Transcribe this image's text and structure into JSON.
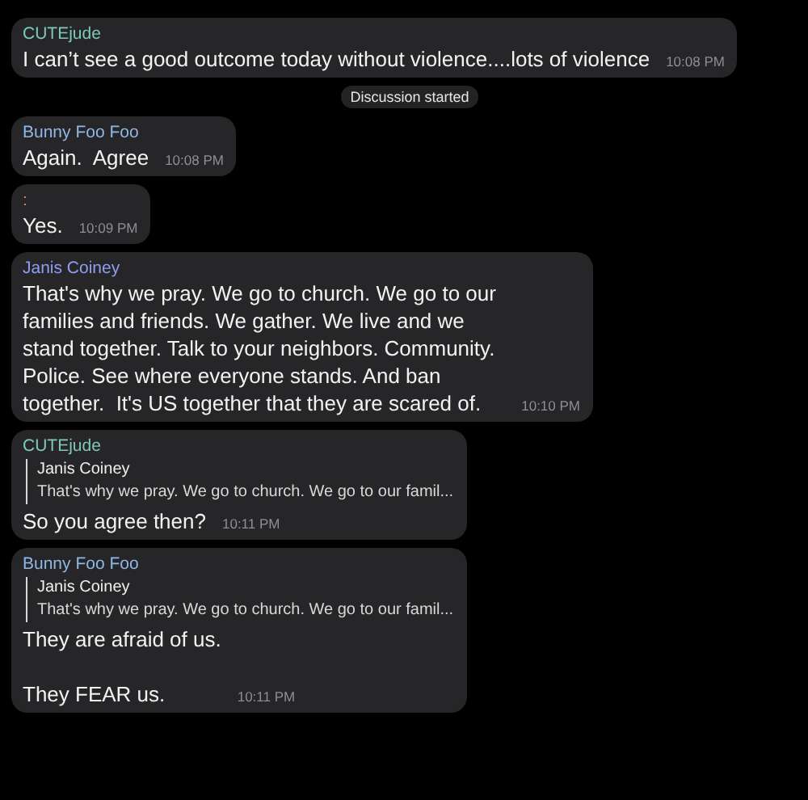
{
  "messages": [
    {
      "kind": "message",
      "sender": "CUTEjude",
      "color": "#7ec9b5",
      "text": "I can’t see a good outcome today without violence....lots of violence",
      "time": "10:08 PM"
    },
    {
      "kind": "notice",
      "text": "Discussion started"
    },
    {
      "kind": "message",
      "sender": "Bunny Foo Foo",
      "color": "#8fb8e6",
      "text": "Again.  Agree",
      "time": "10:08 PM"
    },
    {
      "kind": "message",
      "sender": ":",
      "color": "#d9826e",
      "text": "Yes.",
      "time": "10:09 PM"
    },
    {
      "kind": "message",
      "sender": "Janis Coiney",
      "color": "#8f9ef0",
      "text": "That's why we pray. We go to church. We go to our families and friends. We gather. We live and we stand together. Talk to your neighbors. Community. Police. See where everyone stands. And ban together.  It's US together that they are scared of.",
      "time": "10:10 PM"
    },
    {
      "kind": "message",
      "sender": "CUTEjude",
      "color": "#7ec9b5",
      "reply": {
        "name": "Janis Coiney",
        "text": "That's why we pray. We go to church. We go to our famil..."
      },
      "text": "So you agree then?",
      "time": "10:11 PM"
    },
    {
      "kind": "message",
      "sender": "Bunny Foo Foo",
      "color": "#8fb8e6",
      "reply": {
        "name": "Janis Coiney",
        "text": "That's why we pray. We go to church. We go to our famil..."
      },
      "text": "They are afraid of us.\n\nThey FEAR us.",
      "time": "10:11 PM"
    }
  ]
}
